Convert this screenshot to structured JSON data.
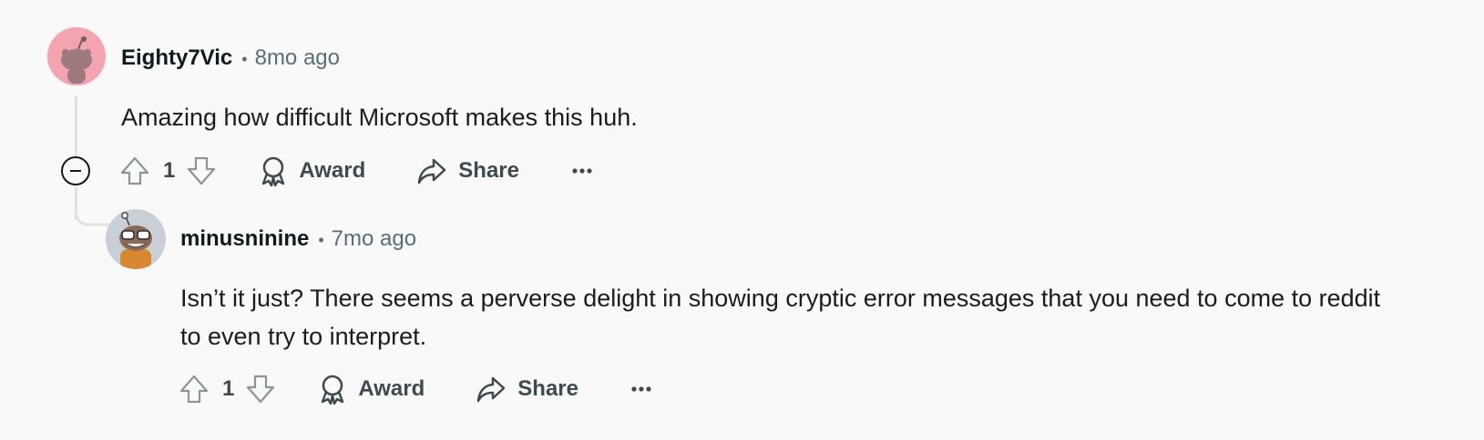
{
  "comments": [
    {
      "username": "Eighty7Vic",
      "separator": "•",
      "time": "8mo ago",
      "body": "Amazing how difficult Microsoft makes this huh.",
      "votes": "1",
      "award_label": "Award",
      "share_label": "Share",
      "avatar_color": "#f4a4b0"
    },
    {
      "username": "minusninine",
      "separator": "•",
      "time": "7mo ago",
      "body": "Isn’t it just? There seems a perverse delight in showing cryptic error messages that you need to come to reddit to even try to interpret.",
      "votes": "1",
      "award_label": "Award",
      "share_label": "Share",
      "avatar_color": "#c9cfd6"
    }
  ],
  "icons": {
    "upvote": "arrow-up-icon",
    "downvote": "arrow-down-icon",
    "award": "award-icon",
    "share": "share-icon",
    "more": "more-horizontal-icon",
    "collapse": "collapse-minus-icon"
  }
}
